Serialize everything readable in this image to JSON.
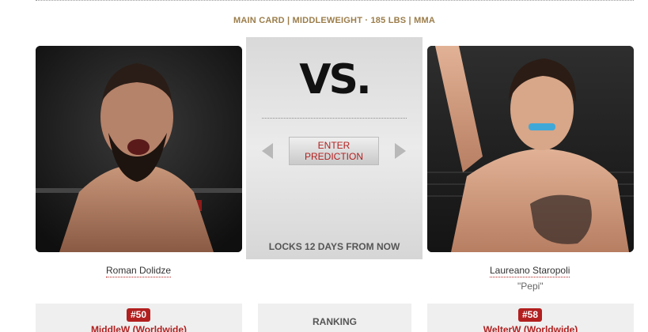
{
  "bout": {
    "header": "MAIN CARD | MIDDLEWEIGHT · 185 LBS | MMA"
  },
  "fighters": [
    {
      "name": "Roman Dolidze",
      "nickname": "",
      "rank": "#50",
      "division": "MiddleW (Worldwide)"
    },
    {
      "name": "Laureano Staropoli",
      "nickname": "\"Pepi\"",
      "rank": "#58",
      "division": "WelterW (Worldwide)"
    }
  ],
  "center": {
    "vs": "VS.",
    "predict_button": "ENTER\nPREDICTION",
    "locks": "LOCKS 12 DAYS FROM NOW",
    "ranking_label": "RANKING"
  },
  "icons": {
    "prev": "arrow-left-icon",
    "next": "arrow-right-icon"
  },
  "colors": {
    "accent": "#b21f1f",
    "header_gold": "#9b7d4a",
    "panel_gray": "#e3e3e3"
  }
}
